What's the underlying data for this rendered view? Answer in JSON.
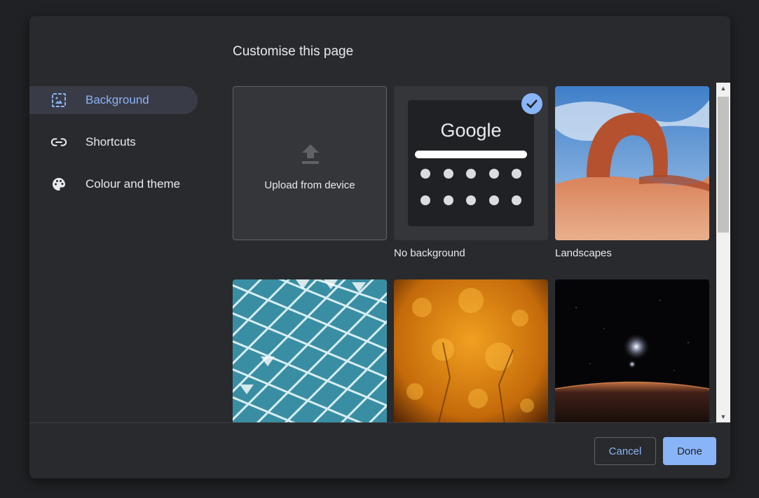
{
  "dialog": {
    "title": "Customise this page"
  },
  "sidebar": {
    "items": [
      {
        "label": "Background",
        "icon": "image-icon",
        "active": true
      },
      {
        "label": "Shortcuts",
        "icon": "link-icon",
        "active": false
      },
      {
        "label": "Colour and theme",
        "icon": "palette-icon",
        "active": false
      }
    ]
  },
  "backgrounds": {
    "upload_label": "Upload from device",
    "no_background": {
      "label": "No background",
      "logo_text": "Google",
      "selected": true
    },
    "landscapes": {
      "label": "Landscapes"
    }
  },
  "footer": {
    "cancel_label": "Cancel",
    "done_label": "Done"
  },
  "colors": {
    "accent": "#8ab4f8",
    "surface": "#292a2d",
    "page_background": "#202124",
    "text": "#e8eaed"
  }
}
